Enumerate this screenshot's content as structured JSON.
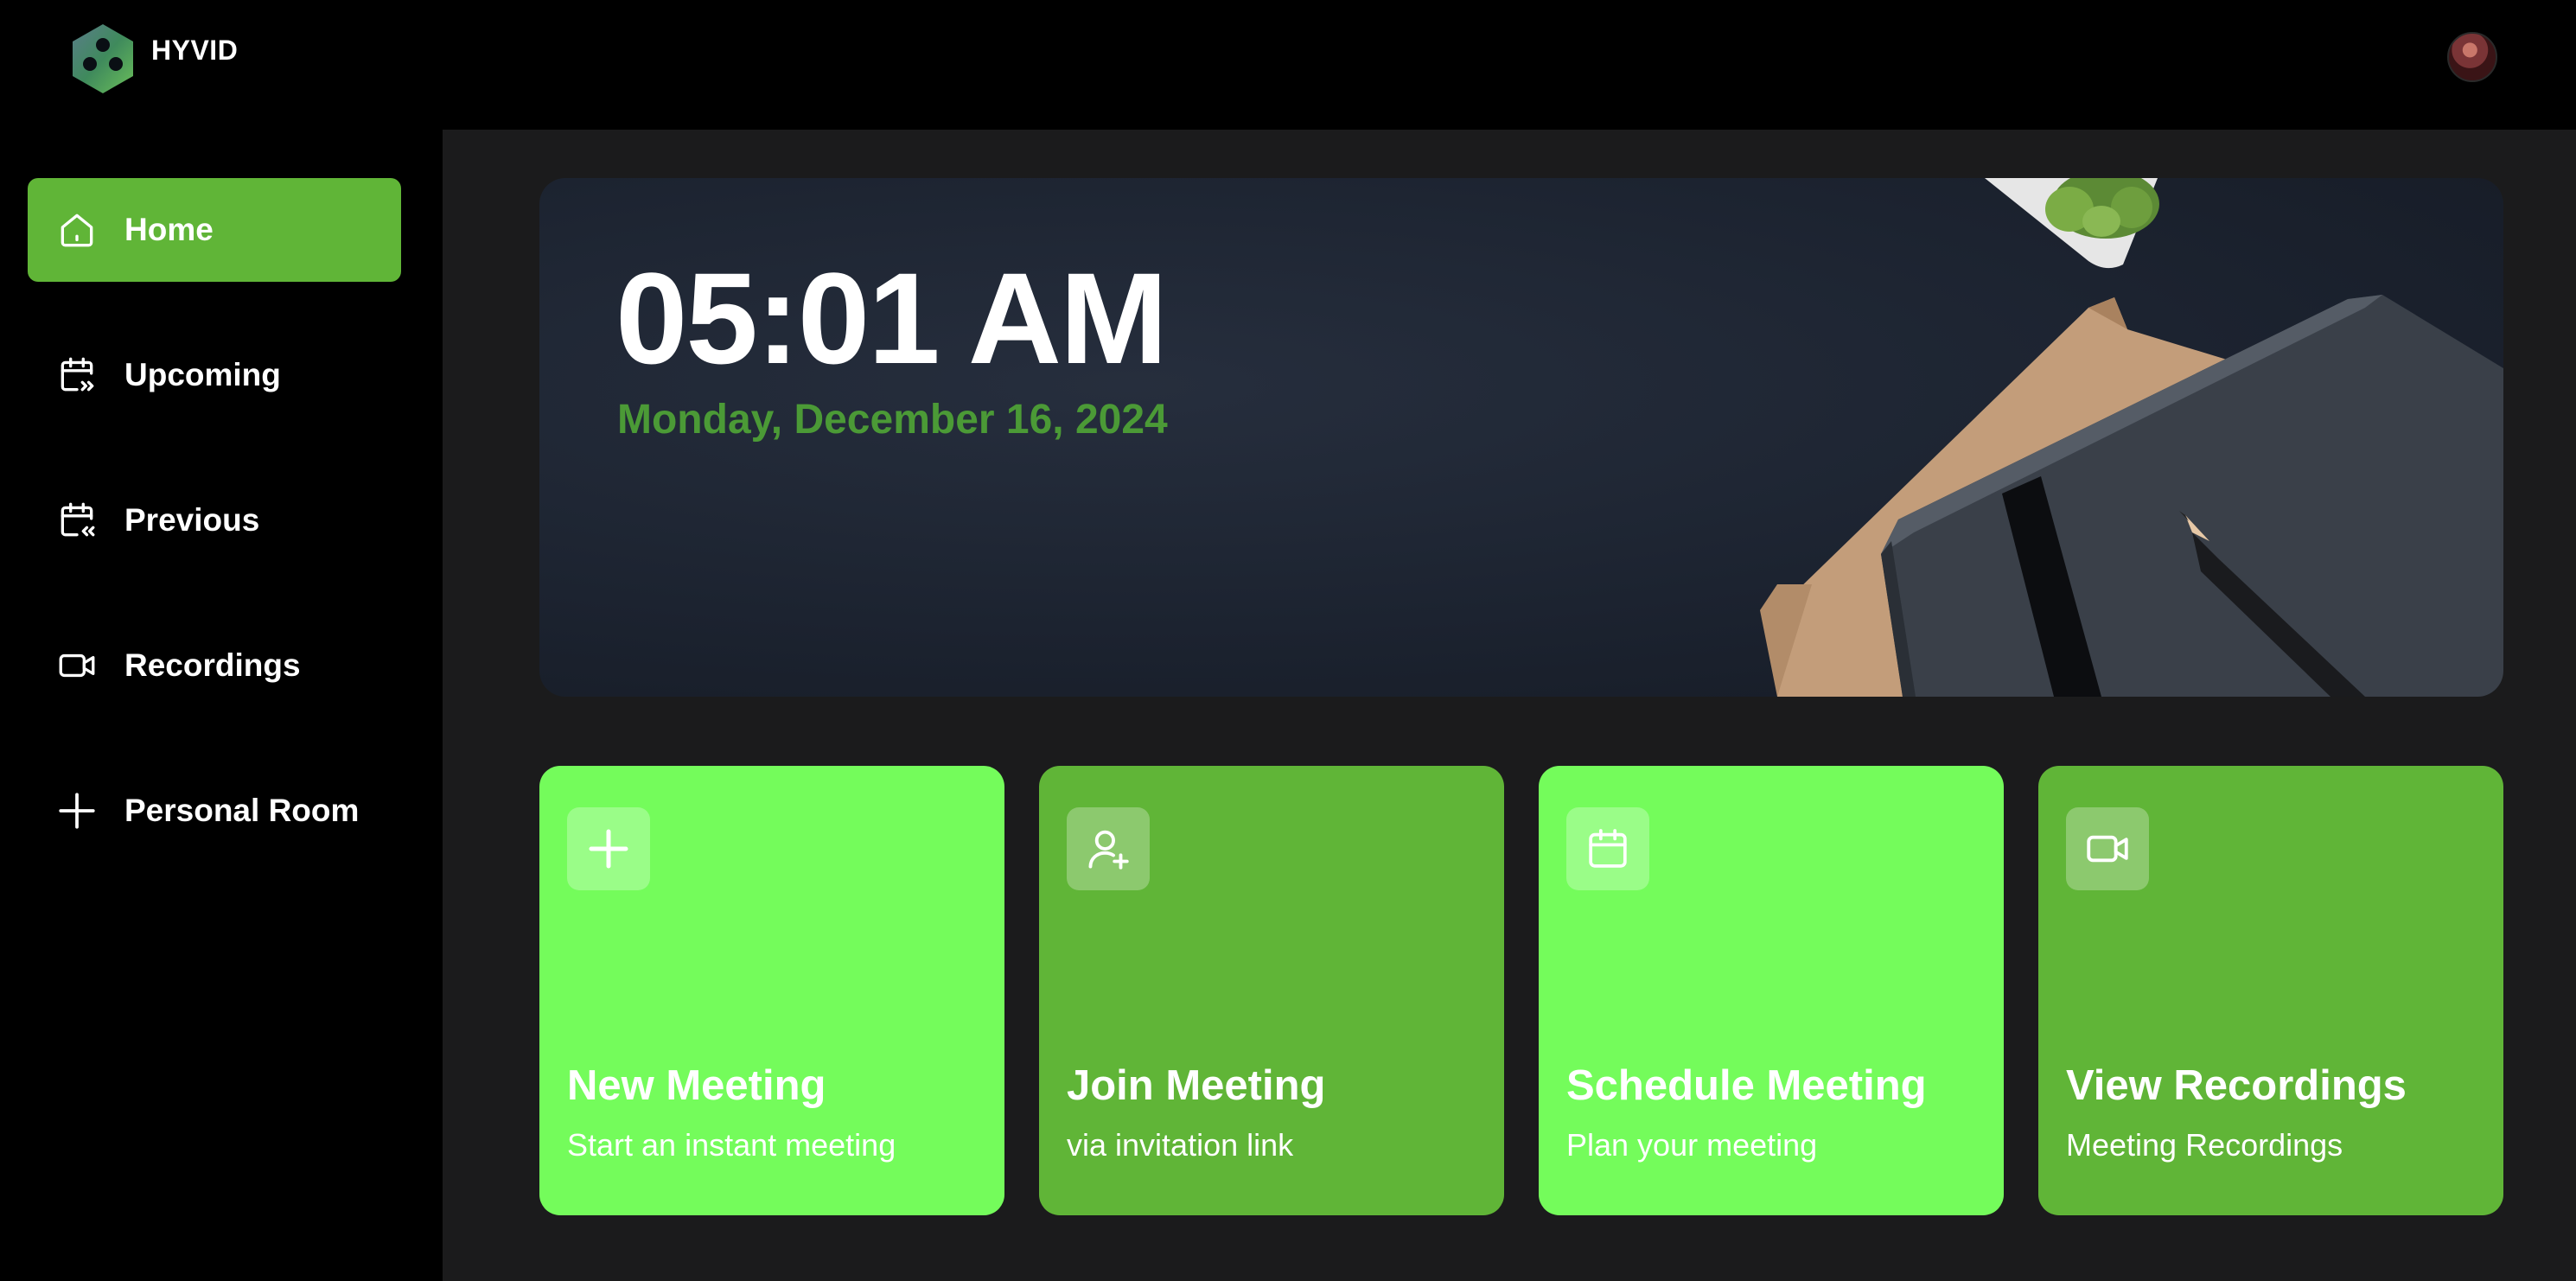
{
  "app": {
    "brand": "HYVID"
  },
  "sidebar": {
    "items": [
      {
        "label": "Home",
        "icon": "home-icon",
        "active": true
      },
      {
        "label": "Upcoming",
        "icon": "calendar-forward-icon",
        "active": false
      },
      {
        "label": "Previous",
        "icon": "calendar-back-icon",
        "active": false
      },
      {
        "label": "Recordings",
        "icon": "video-icon",
        "active": false
      },
      {
        "label": "Personal Room",
        "icon": "plus-icon",
        "active": false
      }
    ]
  },
  "hero": {
    "time": "05:01 AM",
    "date": "Monday, December 16, 2024"
  },
  "cards": [
    {
      "title": "New Meeting",
      "subtitle": "Start an instant meeting",
      "icon": "plus-icon"
    },
    {
      "title": "Join Meeting",
      "subtitle": "via invitation link",
      "icon": "user-add-icon"
    },
    {
      "title": "Schedule Meeting",
      "subtitle": "Plan your meeting",
      "icon": "calendar-icon"
    },
    {
      "title": "View Recordings",
      "subtitle": "Meeting Recordings",
      "icon": "video-icon"
    }
  ],
  "colors": {
    "accent": "#60b537",
    "accent_light": "#74fc5b",
    "date_text": "#4b9a36",
    "background": "#1b1b1c",
    "sidebar": "#000000"
  }
}
